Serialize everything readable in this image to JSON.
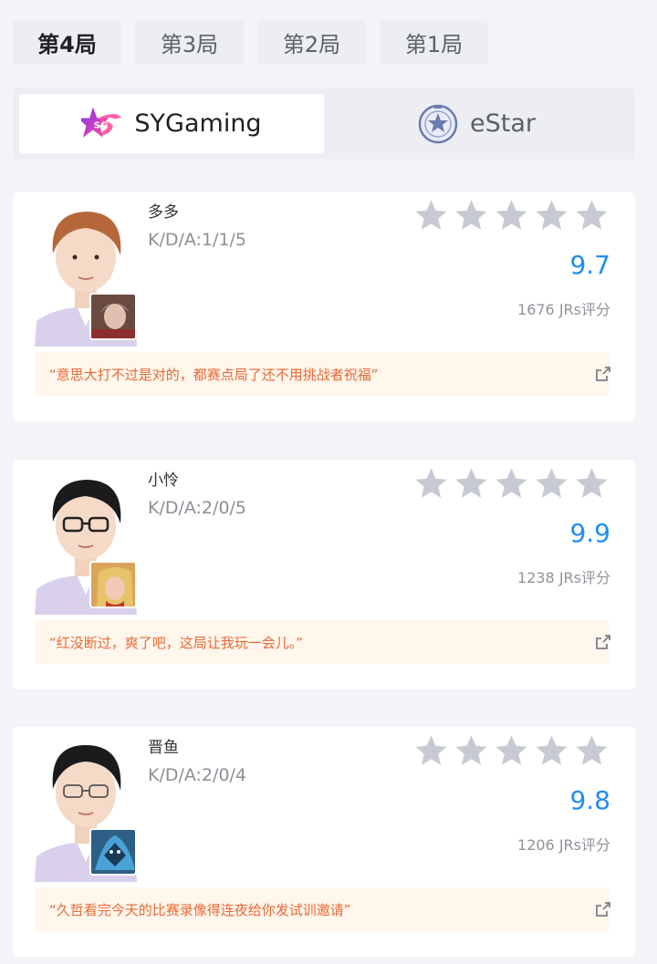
{
  "game_tabs": [
    {
      "label": "第4局",
      "active": true
    },
    {
      "label": "第3局",
      "active": false
    },
    {
      "label": "第2局",
      "active": false
    },
    {
      "label": "第1局",
      "active": false
    }
  ],
  "teams": [
    {
      "name": "SYGaming",
      "active": true
    },
    {
      "name": "eStar",
      "active": false
    }
  ],
  "players": [
    {
      "name": "多多",
      "kda": "K/D/A:1/1/5",
      "score": "9.7",
      "votes": "1676 JRs评分",
      "quote": "“意思大打不过是对的，都赛点局了还不用挑战者祝福”",
      "hair_color": "#b5673a",
      "hero_color": "#6a4a3f",
      "stars": 5
    },
    {
      "name": "小怜",
      "kda": "K/D/A:2/0/5",
      "score": "9.9",
      "votes": "1238 JRs评分",
      "quote": "“红没断过，爽了吧，这局让我玩一会儿。”",
      "hair_color": "#1b1b1d",
      "hero_color": "#d9a55a",
      "stars": 5
    },
    {
      "name": "晋鱼",
      "kda": "K/D/A:2/0/4",
      "score": "9.8",
      "votes": "1206 JRs评分",
      "quote": "“久哲看完今天的比赛录像得连夜给你发试训邀请”",
      "hair_color": "#1b1b1d",
      "hero_color": "#2e5f84",
      "stars": 5
    }
  ],
  "colors": {
    "score_blue": "#1f8ef1",
    "star_gray": "#c7cad3",
    "quote_orange": "#e86a36",
    "sy_purple": "#7b2ff2",
    "sy_pink": "#ff4f9e"
  }
}
